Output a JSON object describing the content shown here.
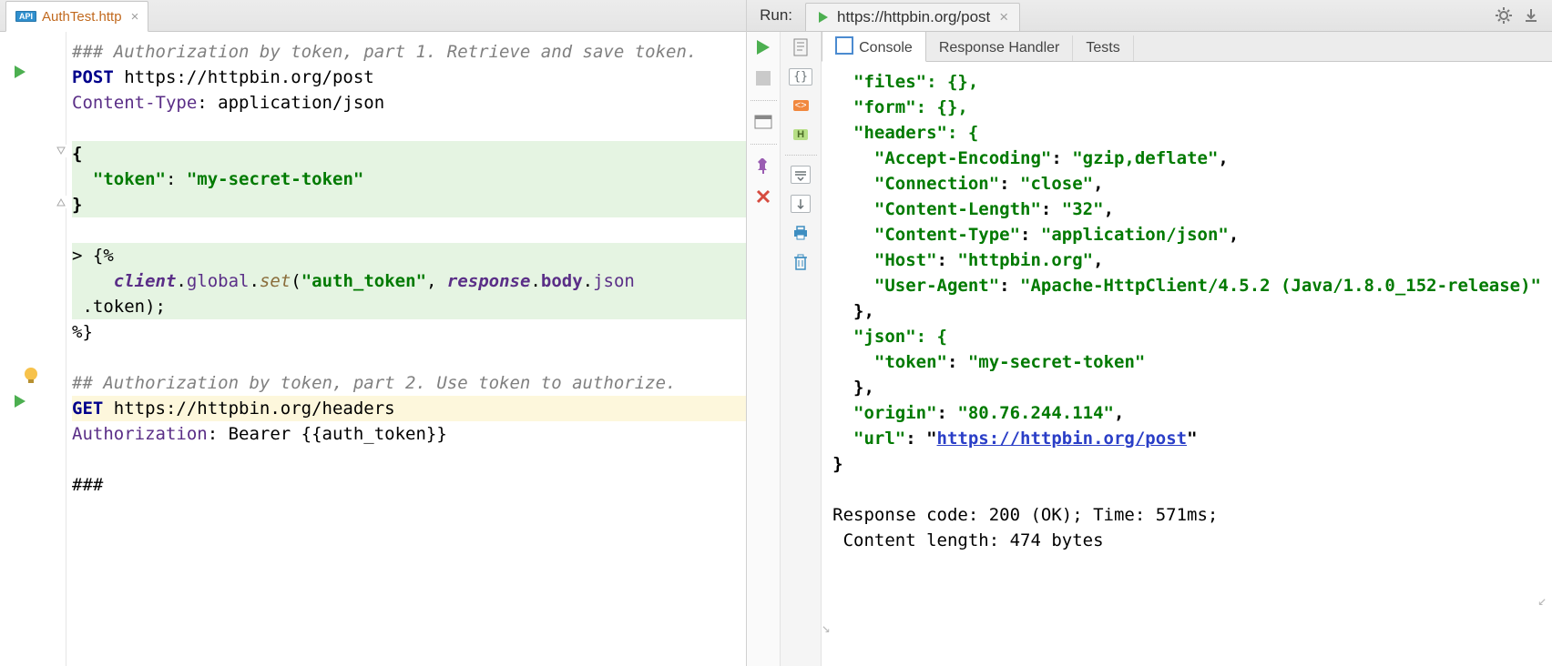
{
  "file_tab": {
    "name": "AuthTest.http"
  },
  "code": {
    "comment1": "### Authorization by token, part 1. Retrieve and save token.",
    "method1": "POST",
    "url1": " https://httpbin.org/post",
    "hdr1_name": "Content-Type",
    "hdr1_val": ": application/json",
    "brace_open": "{",
    "body_key": "\"token\"",
    "body_sep": ": ",
    "body_val": "\"my-secret-token\"",
    "brace_close": "}",
    "script_open": "> {%",
    "script_line_pre": "    ",
    "s_client": "client",
    "s_dot1": ".",
    "s_global": "global",
    "s_dot2": ".",
    "s_set": "set",
    "s_call": "(",
    "s_arg1": "\"auth_token\"",
    "s_comma": ", ",
    "s_response": "response",
    "s_dot3": ".",
    "s_body": "body",
    "s_dot4": ".",
    "s_json": "json",
    "script_cont": " .token);",
    "script_close": "%}",
    "comment2_pre": "##",
    "comment2_post": " Authorization by token, part 2. Use token to authorize.",
    "method2": "GET",
    "url2": " https://httpbin.org/headers",
    "hdr2_name": "Authorization",
    "hdr2_val": ": Bearer {{auth_token}}",
    "end_marker": "###"
  },
  "run": {
    "label": "Run:",
    "tab_name": "https://httpbin.org/post"
  },
  "out_tabs": {
    "console": "Console",
    "handler": "Response Handler",
    "tests": "Tests"
  },
  "response": {
    "l1": "  \"files\": {},",
    "l2": "  \"form\": {},",
    "l3": "  \"headers\": {",
    "l4_k": "    \"Accept-Encoding\"",
    "l4_v": "\"gzip,deflate\"",
    "l5_k": "    \"Connection\"",
    "l5_v": "\"close\"",
    "l6_k": "    \"Content-Length\"",
    "l6_v": "\"32\"",
    "l7_k": "    \"Content-Type\"",
    "l7_v": "\"application/json\"",
    "l8_k": "    \"Host\"",
    "l8_v": "\"httpbin.org\"",
    "l9_k": "    \"User-Agent\"",
    "l9_v": "\"Apache-HttpClient/4.5.2 (Java/1.8.0_152-release)\"",
    "l10": "  },",
    "l11": "  \"json\": {",
    "l12_k": "    \"token\"",
    "l12_v": "\"my-secret-token\"",
    "l13": "  },",
    "l14_k": "  \"origin\"",
    "l14_v": "\"80.76.244.114\"",
    "l15_k": "  \"url\"",
    "l15_link": "https://httpbin.org/post",
    "l16": "}",
    "status1": "Response code: 200 (OK); Time: 571ms;",
    "status2": "Content length: 474 bytes"
  }
}
